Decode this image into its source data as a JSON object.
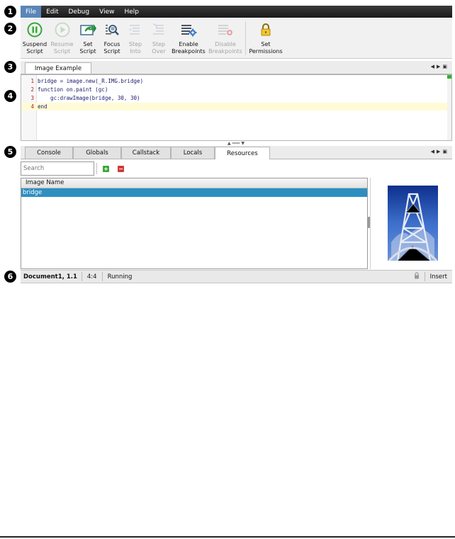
{
  "markers": [
    "1",
    "2",
    "3",
    "4",
    "5",
    "6"
  ],
  "menu": [
    "File",
    "Edit",
    "Debug",
    "View",
    "Help"
  ],
  "toolbar": {
    "suspend": {
      "line1": "Suspend",
      "line2": "Script"
    },
    "resume": {
      "line1": "Resume",
      "line2": "Script"
    },
    "set_script": {
      "line1": "Set",
      "line2": "Script"
    },
    "focus_script": {
      "line1": "Focus",
      "line2": "Script"
    },
    "step_into": {
      "line1": "Step",
      "line2": "Into"
    },
    "step_over": {
      "line1": "Step",
      "line2": "Over"
    },
    "enable_bp": {
      "line1": "Enable",
      "line2": "Breakpoints"
    },
    "disable_bp": {
      "line1": "Disable",
      "line2": "Breakpoints"
    },
    "set_perm": {
      "line1": "Set",
      "line2": "Permissions"
    }
  },
  "editor": {
    "tab": "Image Example",
    "lines": [
      {
        "num": "1",
        "text": "bridge = image.new(_R.IMG.bridge)"
      },
      {
        "num": "2",
        "text": "function on.paint (gc)"
      },
      {
        "num": "3",
        "text": "    gc:drawImage(bridge, 30, 30)"
      },
      {
        "num": "4",
        "text": "end"
      }
    ]
  },
  "bottom_tabs": [
    "Console",
    "Globals",
    "Callstack",
    "Locals",
    "Resources"
  ],
  "resources": {
    "search_placeholder": "Search",
    "add_label": "+",
    "remove_label": "−",
    "column_header": "Image Name",
    "rows": [
      "bridge"
    ]
  },
  "status": {
    "document": "Document1, 1.1",
    "ratio": "4:4",
    "state": "Running",
    "mode": "Insert"
  },
  "colors": {
    "selection": "#2d8fc0",
    "menu_active": "#5a86b8",
    "current_line": "#fffbd6"
  }
}
